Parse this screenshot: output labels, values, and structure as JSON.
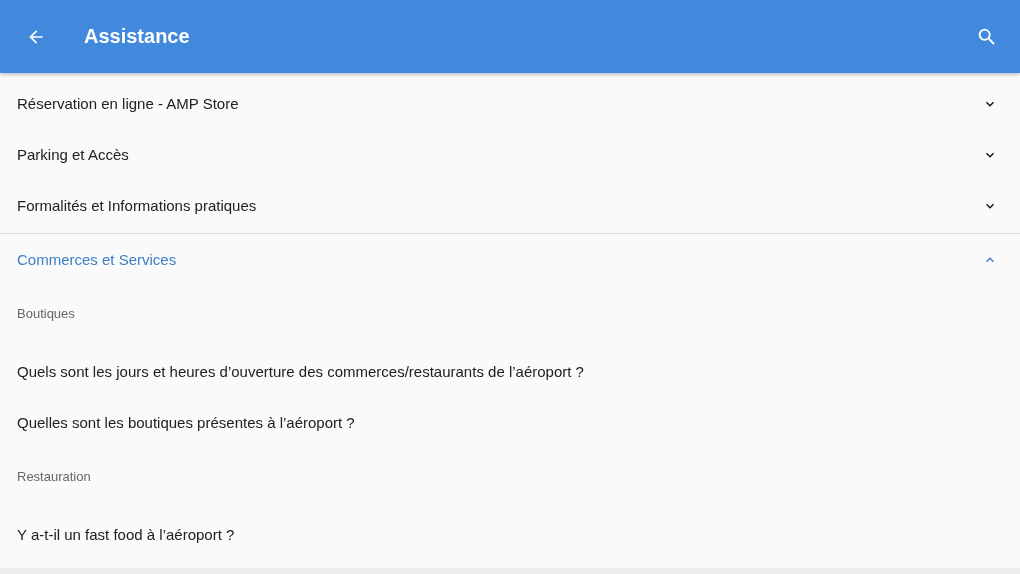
{
  "app_bar": {
    "title": "Assistance"
  },
  "sections": [
    {
      "title": "Réservation en ligne - AMP Store",
      "expanded": false
    },
    {
      "title": "Parking et Accès",
      "expanded": false
    },
    {
      "title": "Formalités et Informations pratiques",
      "expanded": false
    },
    {
      "title": "Commerces et Services",
      "expanded": true,
      "groups": [
        {
          "heading": "Boutiques",
          "questions": [
            "Quels sont les jours et heures d’ouverture des commerces/restaurants de l’aéroport ?",
            "Quelles sont les boutiques présentes à l’aéroport ?"
          ]
        },
        {
          "heading": "Restauration",
          "questions": [
            "Y a-t-il un fast food à l’aéroport ?"
          ]
        }
      ]
    }
  ]
}
